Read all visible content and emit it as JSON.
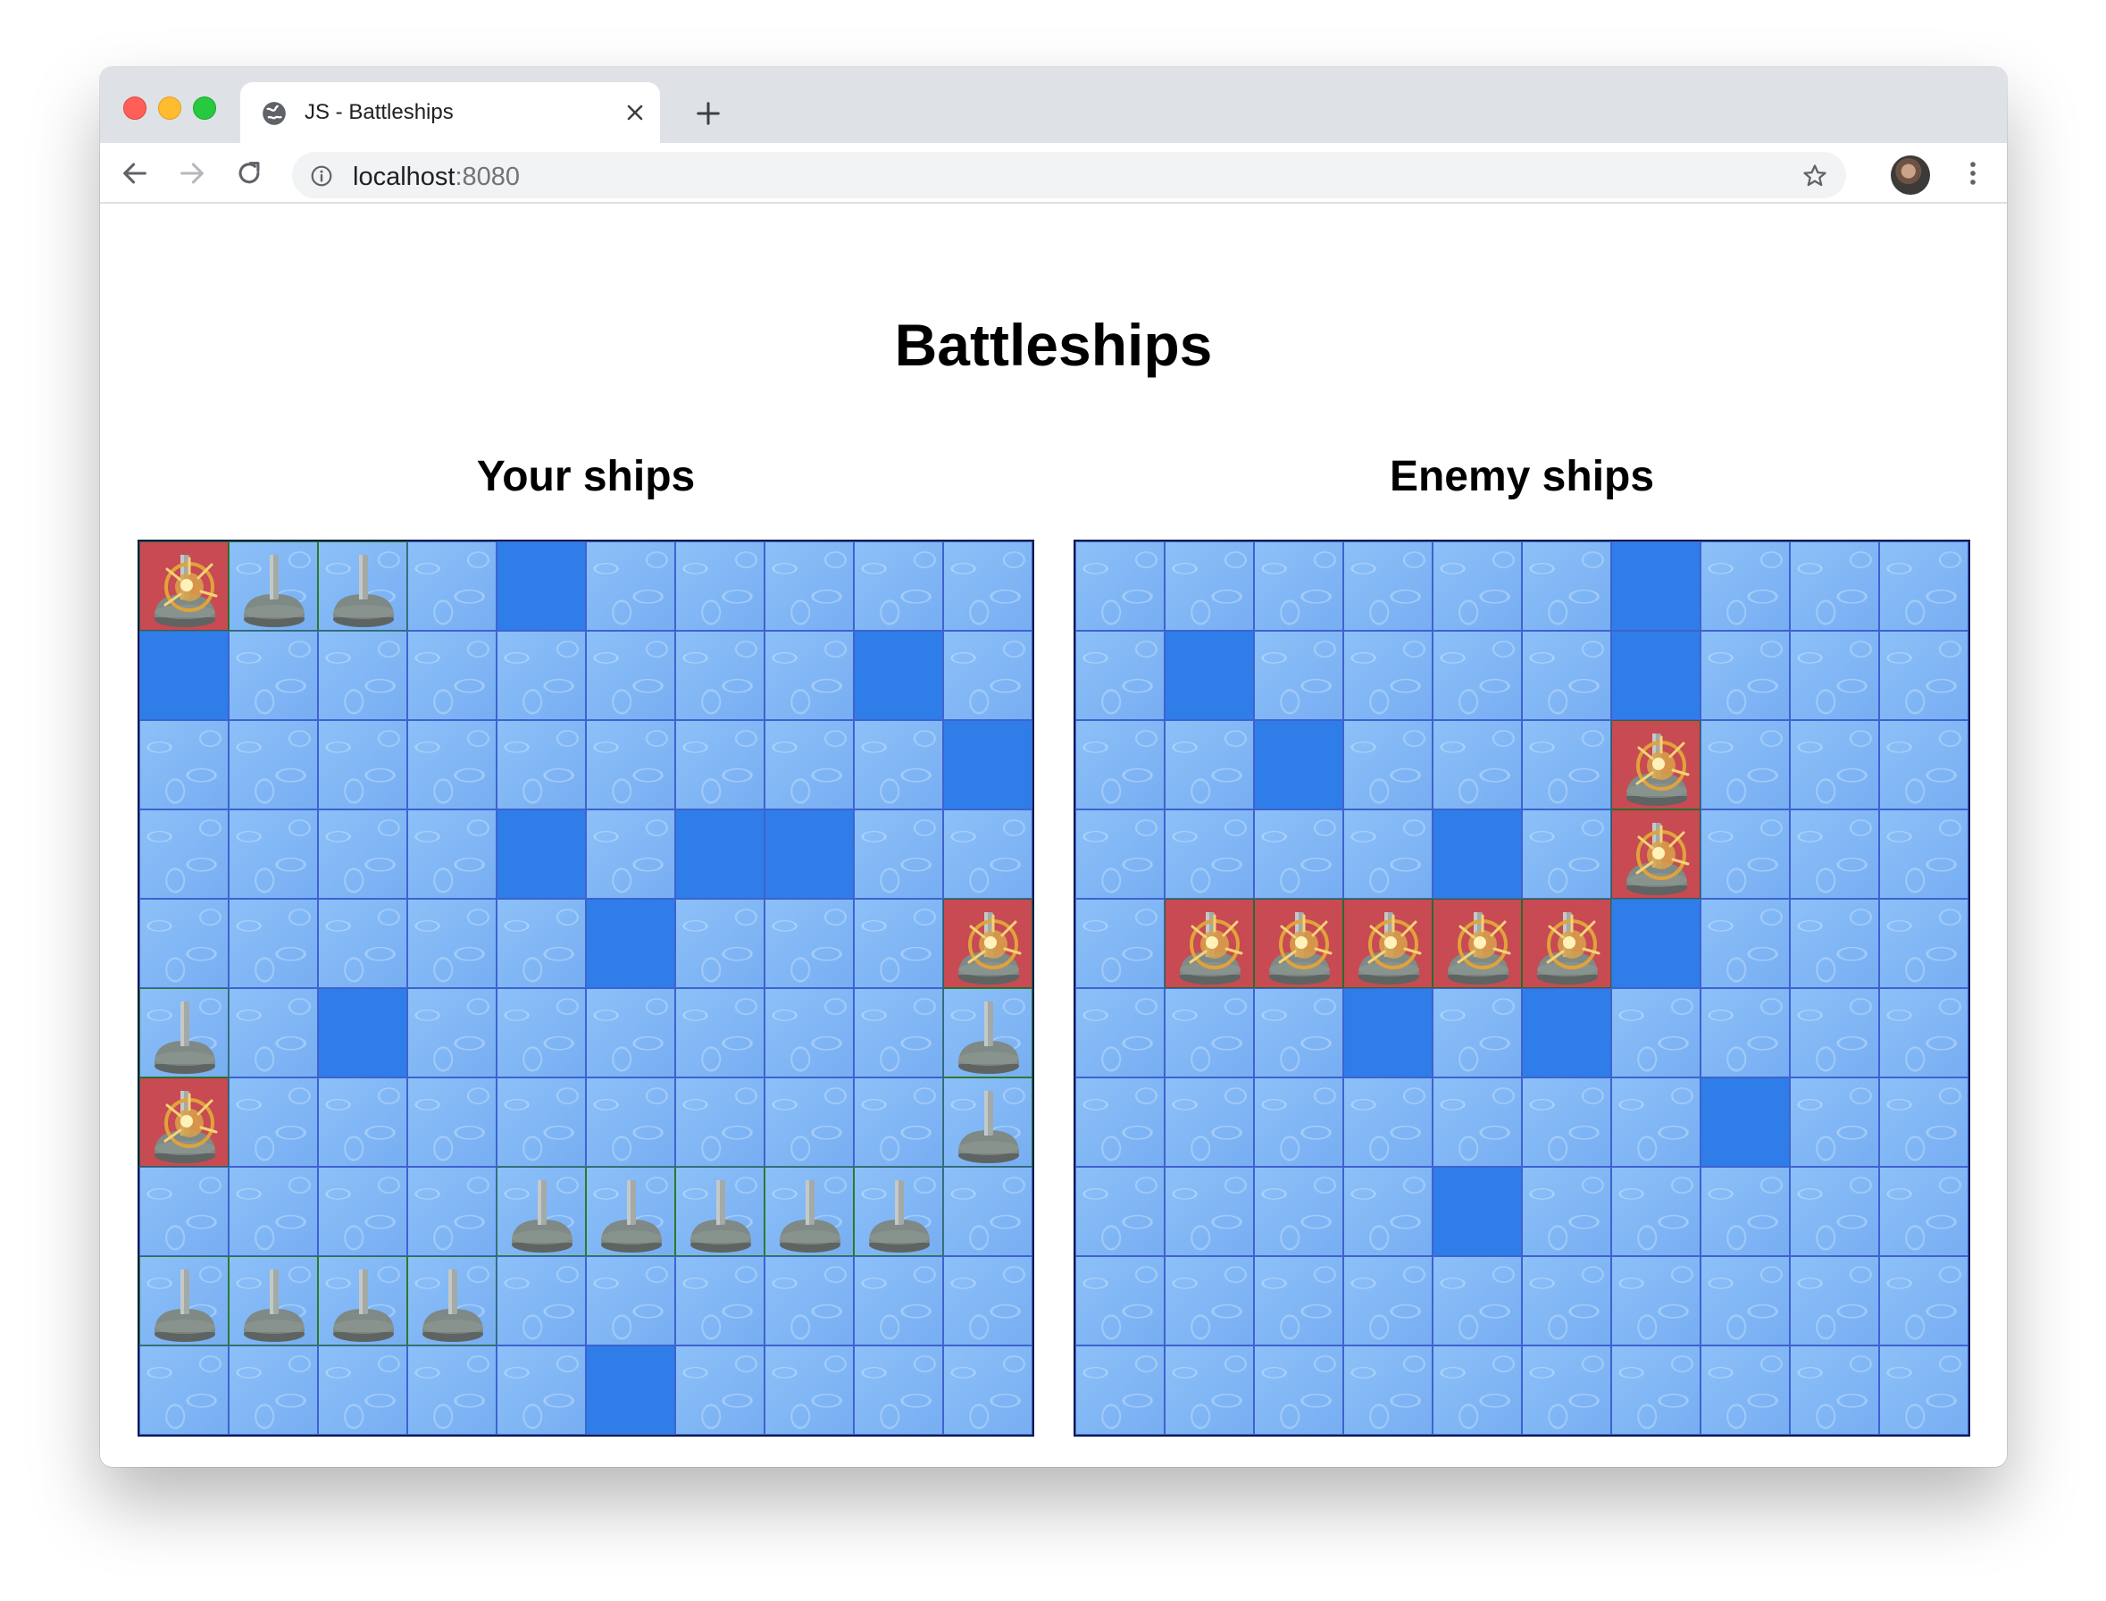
{
  "browser": {
    "tab_title": "JS - Battleships",
    "url_host": "localhost",
    "url_port": ":8080"
  },
  "page": {
    "title": "Battleships"
  },
  "boards": {
    "player": {
      "title": "Your ships",
      "rows": [
        "HSS.M.....",
        "M.......M.",
        ".........M",
        "....M.MM..",
        ".....M...H",
        "S.M......S",
        "H........S",
        "....SSSSS.",
        "SSSS......",
        ".....M...."
      ]
    },
    "enemy": {
      "title": "Enemy ships",
      "rows": [
        "......M...",
        ".M....M...",
        "..M...H...",
        "....M.H...",
        ".HHHHHM...",
        "...M.M....",
        ".......M..",
        "....M.....",
        "..........",
        ".........."
      ]
    }
  },
  "colors": {
    "water": "#82b7f6",
    "miss": "#2f7de8",
    "hit": "#c84a52",
    "ship_border": "#2b7a2b",
    "grid_line": "#3f62d0"
  },
  "icons": {
    "ship": "ship-turret-icon",
    "hit": "explosion-icon"
  }
}
